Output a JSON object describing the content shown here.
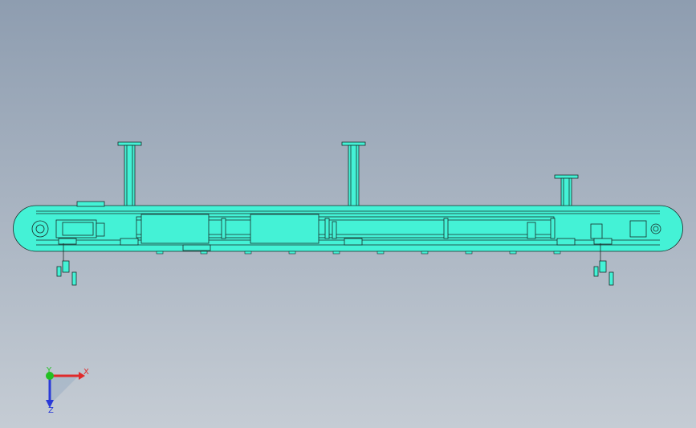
{
  "viewport": {
    "background_top": "#8e9db0",
    "background_bottom": "#c5ccd4"
  },
  "model": {
    "name": "conveyor-assembly",
    "fill_color": "#44f2d6",
    "edge_color": "#1a2a28",
    "accent_blue": "#3d6fd0"
  },
  "triad": {
    "x_label": "X",
    "y_label": "Y",
    "z_label": "Z",
    "x_color": "#e02a2a",
    "y_color": "#22c022",
    "z_color": "#2a3ad8"
  }
}
